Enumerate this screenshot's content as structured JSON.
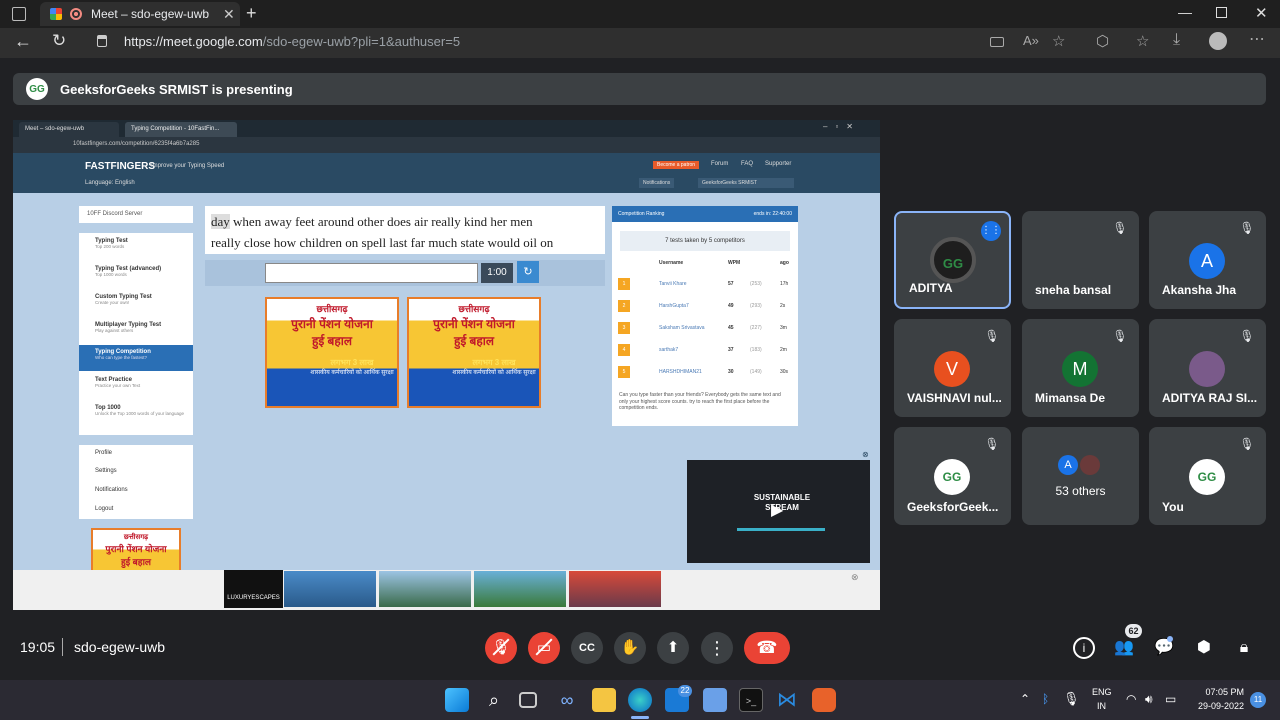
{
  "browser": {
    "tab_title": "Meet – sdo-egew-uwb",
    "new_tab_symbol": "+",
    "url_host": "https://meet.google.com",
    "url_path": "/sdo-egew-uwb?pli=1&authuser=5"
  },
  "meet": {
    "banner_text": "GeeksforGeeks SRMIST is presenting",
    "time": "19:05",
    "meeting_code": "sdo-egew-uwb",
    "people_badge": "62",
    "participants": [
      {
        "name": "ADITYA",
        "initial": "",
        "color": "#1e1e1e",
        "active": true
      },
      {
        "name": "sneha bansal",
        "initial": "",
        "color": "#1e1e1e",
        "active": false
      },
      {
        "name": "Akansha Jha",
        "initial": "A",
        "color": "#1a73e8",
        "active": false
      },
      {
        "name": "VAISHNAVI nul...",
        "initial": "V",
        "color": "#e8501f",
        "active": false
      },
      {
        "name": "Mimansa De",
        "initial": "M",
        "color": "#137333",
        "active": false
      },
      {
        "name": "ADITYA RAJ SI...",
        "initial": "",
        "color": "#7a5a8a",
        "active": false
      },
      {
        "name": "GeeksforGeek...",
        "initial": "",
        "color": "#2f8d46",
        "active": false
      },
      {
        "name": "53 others",
        "initial": "A",
        "color": "#1a73e8",
        "active": false
      },
      {
        "name": "You",
        "initial": "",
        "color": "#2f8d46",
        "active": false
      }
    ]
  },
  "shared": {
    "tab1": "Meet – sdo-egew-uwb",
    "tab2": "Typing Competition - 10FastFin...",
    "url": "10fastfingers.com/competition/6235f4a6b7a285",
    "logo": "FASTFINGERS",
    "tagline": "Improve your Typing Speed",
    "language": "Language: English",
    "patron": "Become a patron",
    "nav": [
      "Forum",
      "FAQ",
      "Supporter"
    ],
    "notifications": "Notifications",
    "user": "GeeksforGeeks SRMIST",
    "discord": "10FF Discord Server",
    "menu": [
      {
        "title": "Typing Test",
        "sub": "Top 200 words"
      },
      {
        "title": "Typing Test (advanced)",
        "sub": "Top 1000 words"
      },
      {
        "title": "Custom Typing Test",
        "sub": "Create your own!"
      },
      {
        "title": "Multiplayer Typing Test",
        "sub": "Play against others"
      },
      {
        "title": "Typing Competition",
        "sub": "Who can type the fastest?"
      },
      {
        "title": "Text Practice",
        "sub": "Practice your own Text"
      },
      {
        "title": "Top 1000",
        "sub": "Unlock the Top 1000 words of your language"
      }
    ],
    "account": [
      "Profile",
      "Settings",
      "Notifications",
      "Logout"
    ],
    "highlight_word": "day",
    "line1": " when away feet around other does air really kind her men",
    "line2": "really close how children on spell last far much state would oil on",
    "timer": "1:00",
    "ranking_title": "Competition Ranking",
    "ranking_ends": "ends in: 22:40:00",
    "tests_taken": "7 tests taken by 5 competitors",
    "cols": [
      "Username",
      "WPM",
      "ago"
    ],
    "rows": [
      {
        "rank": "1",
        "name": "Tanvii Khare",
        "wpm": "57",
        "keys": "(253)",
        "ago": "17h"
      },
      {
        "rank": "2",
        "name": "HarshGupta7",
        "wpm": "49",
        "keys": "(293)",
        "ago": "2s"
      },
      {
        "rank": "3",
        "name": "Saksham Srivastava",
        "wpm": "45",
        "keys": "(227)",
        "ago": "3m"
      },
      {
        "rank": "4",
        "name": "sarthak7",
        "wpm": "37",
        "keys": "(183)",
        "ago": "2m"
      },
      {
        "rank": "5",
        "name": "HARSHDHIMAN21",
        "wpm": "30",
        "keys": "(149)",
        "ago": "30s"
      }
    ],
    "ranking_note": "Can you type faster than your friends? Everybody gets the same text and only your highest score counts. try to reach the first place before the competition ends.",
    "ad_line1": "छत्तीसगढ़",
    "ad_line2": "पुरानी पेंशन योजना",
    "ad_line3": "हुई बहाल",
    "ad_line4": "लगभग 3 लाख",
    "ad_line5": "शासकीय कर्मचारियों को आर्थिक सुरक्षा",
    "video_brand": "SUSTAINABLE STREAM",
    "bottom_ad_brand": "LUXURYESCAPES"
  },
  "taskbar": {
    "lang": "ENG",
    "region": "IN",
    "clock": "07:05 PM",
    "date": "29-09-2022",
    "mail_badge": "22",
    "notif_badge": "11"
  }
}
